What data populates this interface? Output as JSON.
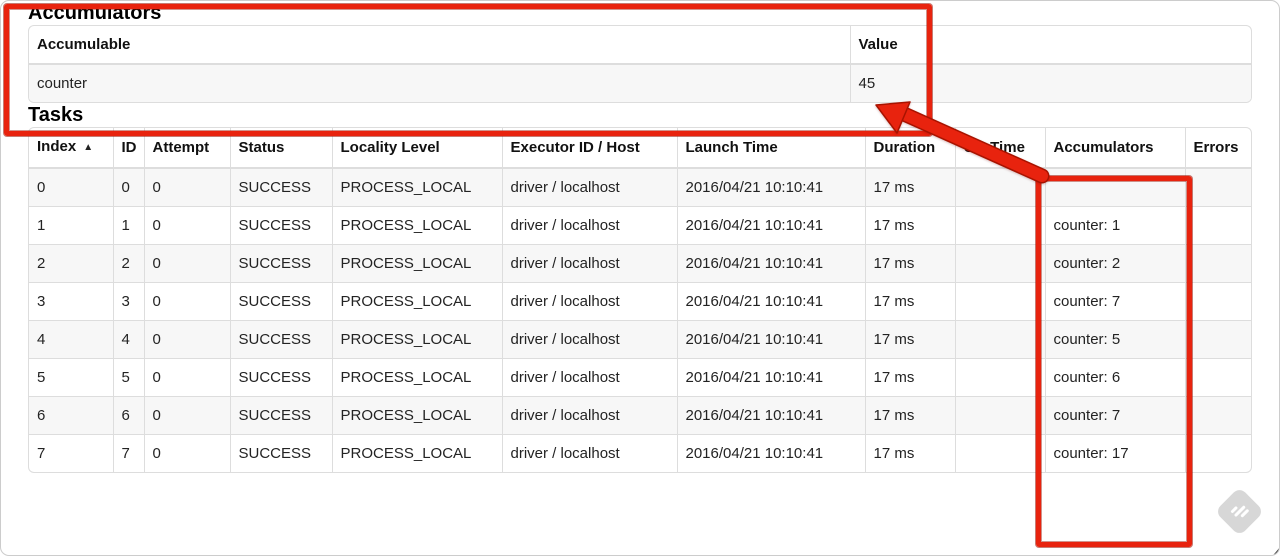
{
  "annotation": {
    "color": "#e8230e"
  },
  "icons": {
    "sort_ascending": "▲",
    "watermark": "skitch-logo"
  },
  "page": {
    "accumulators": {
      "title": "Accumulators",
      "table": {
        "headers": [
          "Accumulable",
          "Value"
        ],
        "rows": [
          {
            "accumulable": "counter",
            "value": "45"
          }
        ]
      }
    },
    "tasks": {
      "title": "Tasks",
      "table": {
        "headers": [
          "Index",
          "ID",
          "Attempt",
          "Status",
          "Locality Level",
          "Executor ID / Host",
          "Launch Time",
          "Duration",
          "GC Time",
          "Accumulators",
          "Errors"
        ],
        "rows": [
          [
            "0",
            "0",
            "0",
            "SUCCESS",
            "PROCESS_LOCAL",
            "driver / localhost",
            "2016/04/21 10:10:41",
            "17 ms",
            "",
            "",
            ""
          ],
          [
            "1",
            "1",
            "0",
            "SUCCESS",
            "PROCESS_LOCAL",
            "driver / localhost",
            "2016/04/21 10:10:41",
            "17 ms",
            "",
            "counter: 1",
            ""
          ],
          [
            "2",
            "2",
            "0",
            "SUCCESS",
            "PROCESS_LOCAL",
            "driver / localhost",
            "2016/04/21 10:10:41",
            "17 ms",
            "",
            "counter: 2",
            ""
          ],
          [
            "3",
            "3",
            "0",
            "SUCCESS",
            "PROCESS_LOCAL",
            "driver / localhost",
            "2016/04/21 10:10:41",
            "17 ms",
            "",
            "counter: 7",
            ""
          ],
          [
            "4",
            "4",
            "0",
            "SUCCESS",
            "PROCESS_LOCAL",
            "driver / localhost",
            "2016/04/21 10:10:41",
            "17 ms",
            "",
            "counter: 5",
            ""
          ],
          [
            "5",
            "5",
            "0",
            "SUCCESS",
            "PROCESS_LOCAL",
            "driver / localhost",
            "2016/04/21 10:10:41",
            "17 ms",
            "",
            "counter: 6",
            ""
          ],
          [
            "6",
            "6",
            "0",
            "SUCCESS",
            "PROCESS_LOCAL",
            "driver / localhost",
            "2016/04/21 10:10:41",
            "17 ms",
            "",
            "counter: 7",
            ""
          ],
          [
            "7",
            "7",
            "0",
            "SUCCESS",
            "PROCESS_LOCAL",
            "driver / localhost",
            "2016/04/21 10:10:41",
            "17 ms",
            "",
            "counter: 17",
            ""
          ]
        ]
      }
    }
  }
}
